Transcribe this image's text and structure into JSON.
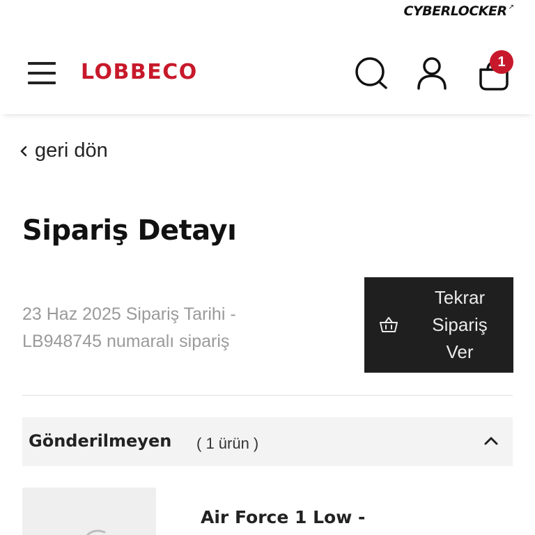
{
  "top_brand": {
    "name": "CYBERLOCKER",
    "arrow": "↗"
  },
  "header": {
    "logo": "LOBBECO",
    "cart_count": "1"
  },
  "icons": {
    "menu": "menu-icon",
    "search": "search-icon",
    "user": "user-icon",
    "cart": "shopping-bag-icon",
    "back": "chevron-left-icon",
    "reorder": "basket-icon",
    "collapse": "chevron-up-icon"
  },
  "colors": {
    "brand": "#c7192b",
    "button_bg": "#1f1f1f",
    "section_bg": "#f3f3f3"
  },
  "nav": {
    "back_label": "geri dön"
  },
  "page": {
    "title": "Sipariş Detayı",
    "order_date_line": "23 Haz 2025 Sipariş Tarihi -",
    "order_number_line": "LB948745 numaralı sipariş",
    "reorder_button": {
      "line1": "Tekrar",
      "line2": "Sipariş",
      "line3": "Ver"
    }
  },
  "section": {
    "title": "Gönderilmeyen",
    "count": "( 1 ürün )"
  },
  "products": [
    {
      "name": "Air Force 1 Low -"
    }
  ]
}
